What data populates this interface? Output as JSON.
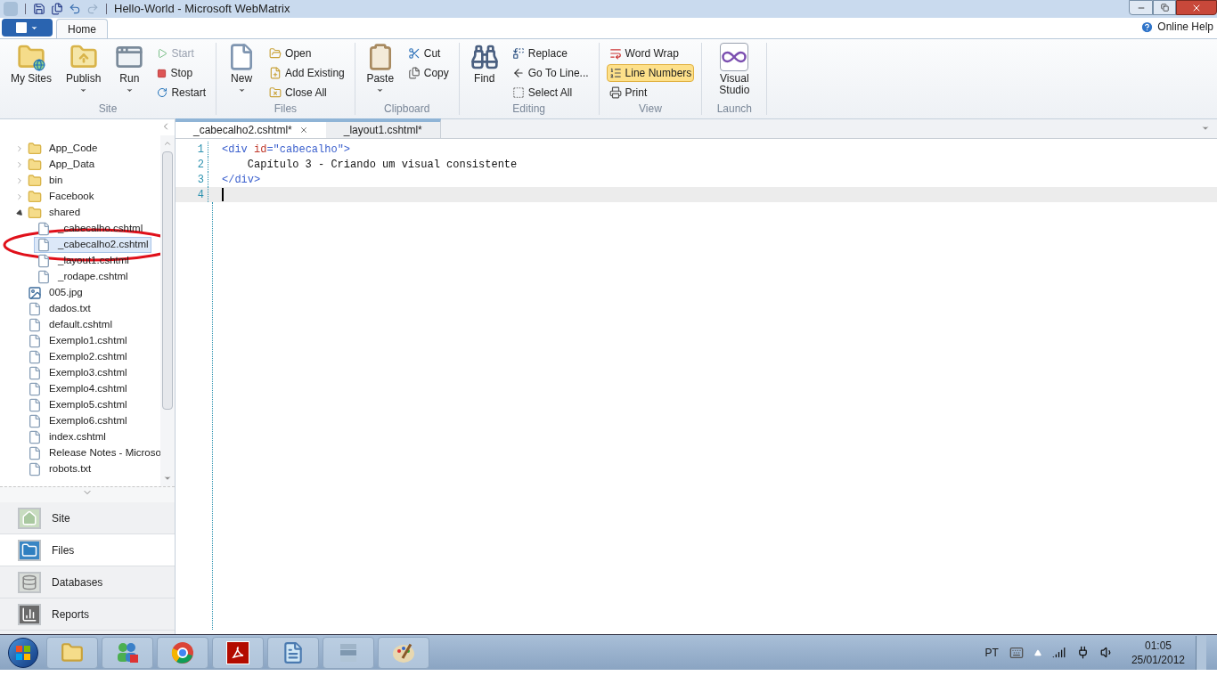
{
  "window": {
    "title": "Hello-World - Microsoft WebMatrix"
  },
  "ribbon": {
    "tabs": [
      {
        "label": "Home",
        "selected": true
      }
    ],
    "help": "Online Help",
    "groups": [
      {
        "label": "Site",
        "items": [
          {
            "kind": "large",
            "label": "My Sites",
            "dropdown": false,
            "disabled": false,
            "selected": false
          },
          {
            "kind": "large",
            "label": "Publish",
            "dropdown": true,
            "disabled": false,
            "selected": false
          },
          {
            "kind": "large",
            "label": "Run",
            "dropdown": true,
            "disabled": false,
            "selected": false
          },
          {
            "kind": "small",
            "label": "Start",
            "disabled": true,
            "selected": false
          },
          {
            "kind": "small",
            "label": "Stop",
            "disabled": false,
            "selected": false
          },
          {
            "kind": "small",
            "label": "Restart",
            "disabled": false,
            "selected": false
          }
        ]
      },
      {
        "label": "Files",
        "items": [
          {
            "kind": "large",
            "label": "New",
            "dropdown": true,
            "disabled": false,
            "selected": false
          },
          {
            "kind": "small",
            "label": "Open",
            "disabled": false,
            "selected": false
          },
          {
            "kind": "small",
            "label": "Add Existing",
            "disabled": false,
            "selected": false
          },
          {
            "kind": "small",
            "label": "Close All",
            "disabled": false,
            "selected": false
          }
        ]
      },
      {
        "label": "Clipboard",
        "items": [
          {
            "kind": "large",
            "label": "Paste",
            "dropdown": true,
            "disabled": false,
            "selected": false
          },
          {
            "kind": "small",
            "label": "Cut",
            "disabled": false,
            "selected": false
          },
          {
            "kind": "small",
            "label": "Copy",
            "disabled": false,
            "selected": false
          }
        ]
      },
      {
        "label": "Editing",
        "items": [
          {
            "kind": "large",
            "label": "Find",
            "dropdown": false,
            "disabled": false,
            "selected": false
          },
          {
            "kind": "small",
            "label": "Replace",
            "disabled": false,
            "selected": false
          },
          {
            "kind": "small",
            "label": "Go To Line...",
            "disabled": false,
            "selected": false
          },
          {
            "kind": "small",
            "label": "Select All",
            "disabled": false,
            "selected": false
          }
        ]
      },
      {
        "label": "View",
        "items": [
          {
            "kind": "small",
            "label": "Word Wrap",
            "disabled": false,
            "selected": false
          },
          {
            "kind": "small",
            "label": "Line Numbers",
            "disabled": false,
            "selected": true
          },
          {
            "kind": "small",
            "label": "Print",
            "disabled": false,
            "selected": false
          }
        ]
      },
      {
        "label": "Launch",
        "items": [
          {
            "kind": "large",
            "label": "Visual Studio",
            "dropdown": false,
            "disabled": false,
            "selected": false
          }
        ]
      }
    ]
  },
  "tree": {
    "items": [
      {
        "kind": "folder",
        "label": "App_Code",
        "expanded": false,
        "selected": false
      },
      {
        "kind": "folder",
        "label": "App_Data",
        "expanded": false,
        "selected": false
      },
      {
        "kind": "folder",
        "label": "bin",
        "expanded": false,
        "selected": false
      },
      {
        "kind": "folder",
        "label": "Facebook",
        "expanded": false,
        "selected": false
      },
      {
        "kind": "folder",
        "label": "shared",
        "expanded": true,
        "selected": false,
        "children": [
          {
            "kind": "file",
            "label": "_cabecalho.cshtml",
            "selected": false
          },
          {
            "kind": "file",
            "label": "_cabecalho2.cshtml",
            "selected": true
          },
          {
            "kind": "file",
            "label": "_layout1.cshtml",
            "selected": false
          },
          {
            "kind": "file",
            "label": "_rodape.cshtml",
            "selected": false
          }
        ]
      },
      {
        "kind": "image",
        "label": "005.jpg",
        "selected": false
      },
      {
        "kind": "file",
        "label": "dados.txt",
        "selected": false
      },
      {
        "kind": "file",
        "label": "default.cshtml",
        "selected": false
      },
      {
        "kind": "file",
        "label": "Exemplo1.cshtml",
        "selected": false
      },
      {
        "kind": "file",
        "label": "Exemplo2.cshtml",
        "selected": false
      },
      {
        "kind": "file",
        "label": "Exemplo3.cshtml",
        "selected": false
      },
      {
        "kind": "file",
        "label": "Exemplo4.cshtml",
        "selected": false
      },
      {
        "kind": "file",
        "label": "Exemplo5.cshtml",
        "selected": false
      },
      {
        "kind": "file",
        "label": "Exemplo6.cshtml",
        "selected": false
      },
      {
        "kind": "file",
        "label": "index.cshtml",
        "selected": false
      },
      {
        "kind": "file",
        "label": "Release Notes - Microso",
        "selected": false
      },
      {
        "kind": "file",
        "label": "robots.txt",
        "selected": false
      }
    ]
  },
  "workspaces": [
    {
      "label": "Site",
      "selected": false
    },
    {
      "label": "Files",
      "selected": true
    },
    {
      "label": "Databases",
      "selected": false
    },
    {
      "label": "Reports",
      "selected": false
    }
  ],
  "editor": {
    "tabs": [
      {
        "label": "_cabecalho2.cshtml*",
        "selected": true
      },
      {
        "label": "_layout1.cshtml*",
        "selected": false
      }
    ],
    "lines": [
      {
        "number": "1",
        "current": false,
        "tokens": [
          {
            "kind": "tag",
            "text": "<div "
          },
          {
            "kind": "attr",
            "text": "id"
          },
          {
            "kind": "tag",
            "text": "=\"cabecalho\">"
          }
        ]
      },
      {
        "number": "2",
        "current": false,
        "tokens": [
          {
            "kind": "text",
            "text": "    Capítulo 3 - Criando um visual consistente"
          }
        ]
      },
      {
        "number": "3",
        "current": false,
        "tokens": [
          {
            "kind": "tag",
            "text": "</div>"
          }
        ]
      },
      {
        "number": "4",
        "current": true
      }
    ]
  },
  "tray": {
    "language": "PT",
    "time": "01:05",
    "date": "25/01/2012"
  }
}
